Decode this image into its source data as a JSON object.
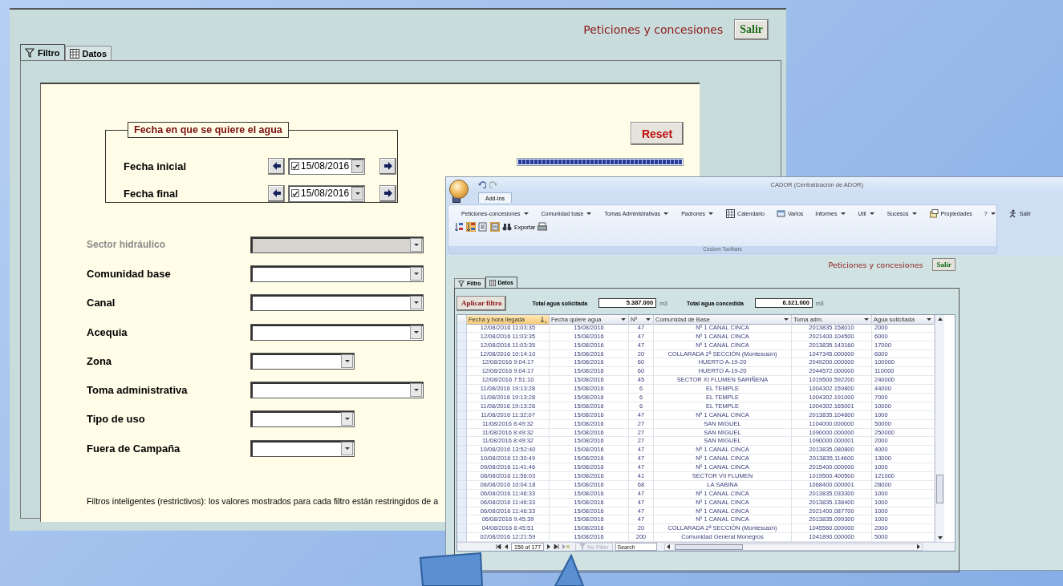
{
  "filter_window": {
    "title": "Peticiones y concesiones",
    "exit_button": "Salir",
    "tabs": [
      {
        "label": "Filtro",
        "selected": true
      },
      {
        "label": "Datos",
        "selected": false
      }
    ],
    "date_group": {
      "legend": "Fecha en que se quiere el agua",
      "dates": [
        {
          "label": "Fecha inicial",
          "value": "15/08/2016",
          "checked": true
        },
        {
          "label": "Fecha final",
          "value": "15/08/2016",
          "checked": true
        }
      ]
    },
    "reset_button": "Reset",
    "progress": {
      "level": 1
    },
    "filters": [
      {
        "label": "Sector hidráulico",
        "kind": "long",
        "disabled": true
      },
      {
        "label": "Comunidad base",
        "kind": "long",
        "disabled": false
      },
      {
        "label": "Canal",
        "kind": "long",
        "disabled": false
      },
      {
        "label": "Acequia",
        "kind": "long",
        "disabled": false
      },
      {
        "label": "Zona",
        "kind": "short",
        "disabled": false
      },
      {
        "label": "Toma administrativa",
        "kind": "long",
        "disabled": false
      },
      {
        "label": "Tipo de uso",
        "kind": "short",
        "disabled": false
      },
      {
        "label": "Fuera de Campaña",
        "kind": "short",
        "disabled": false
      }
    ],
    "note": "Filtros inteligentes (restrictivos): los valores mostrados para cada filtro están restringidos de a"
  },
  "data_window": {
    "app_title": "CADOR (Centralización de ADOR)",
    "ribbon_tab": "Add-Ins",
    "menu": [
      {
        "label": "Peticiones-concesiones",
        "dropdown": true
      },
      {
        "label": "Comunidad base",
        "dropdown": true
      },
      {
        "label": "Tomas Administrativas",
        "dropdown": true
      },
      {
        "label": "Padrones",
        "dropdown": true
      },
      {
        "label": "Calendario",
        "dropdown": false
      },
      {
        "label": "Varios",
        "dropdown": false
      },
      {
        "label": "Informes",
        "dropdown": true
      },
      {
        "label": "Util",
        "dropdown": true
      },
      {
        "label": "Sucesos",
        "dropdown": true
      },
      {
        "label": "Propiedades",
        "dropdown": false
      },
      {
        "label": "?",
        "dropdown": true
      },
      {
        "label": "Salir",
        "dropdown": false
      }
    ],
    "toolbar_button": "Exportar",
    "group_label": "Custom Toolbars",
    "form_title": "Peticiones y concesiones",
    "exit_button": "Salir",
    "tabs": [
      {
        "label": "Filtro",
        "selected": false
      },
      {
        "label": "Datos",
        "selected": true
      }
    ],
    "apply_button": "Aplicar filtro",
    "totals": [
      {
        "label": "Total agua solicitada",
        "value": "5.387.000",
        "unit": "m3"
      },
      {
        "label": "Total agua concedida",
        "value": "6.321.000",
        "unit": "m3"
      }
    ],
    "table": {
      "columns": [
        {
          "label": "Fecha y hora llegada",
          "sorted": true
        },
        {
          "label": "Fecha quiere agua",
          "sorted": false
        },
        {
          "label": "Nº",
          "sorted": false
        },
        {
          "label": "Comunidad de Base",
          "sorted": false
        },
        {
          "label": "Toma adm.",
          "sorted": false
        },
        {
          "label": "Agua solicitada",
          "sorted": false
        }
      ],
      "rows": [
        [
          "12/08/2016 11:03:35",
          "15/08/2016",
          "47",
          "Nº 1 CANAL CINCA",
          "2013835.158010",
          "2000"
        ],
        [
          "12/08/2016 11:03:35",
          "15/08/2016",
          "47",
          "Nº 1 CANAL CINCA",
          "2021400.104500",
          "6000"
        ],
        [
          "12/08/2016 11:03:35",
          "15/08/2016",
          "47",
          "Nº 1 CANAL CINCA",
          "2013835.143160",
          "17000"
        ],
        [
          "12/08/2016 10:14:10",
          "15/08/2016",
          "20",
          "COLLARADA 2ª SECCIÓN (Montesusín)",
          "1047345.000000",
          "6000"
        ],
        [
          "12/08/2016 9:04:17",
          "15/08/2016",
          "60",
          "HUERTO A-19-20",
          "2049200.000000",
          "100000"
        ],
        [
          "12/08/2016 9:04:17",
          "15/08/2016",
          "60",
          "HUERTO A-19-20",
          "2044572.000000",
          "110000"
        ],
        [
          "12/08/2016 7:51:10",
          "15/08/2016",
          "45",
          "SECTOR XI FLUMEN SARIÑENA",
          "1019500.592200",
          "240000"
        ],
        [
          "11/08/2016 19:13:28",
          "15/08/2016",
          "6",
          "EL TEMPLE",
          "1004302.159800",
          "44000"
        ],
        [
          "11/08/2016 19:13:28",
          "15/08/2016",
          "6",
          "EL TEMPLE",
          "1004302.191000",
          "7000"
        ],
        [
          "11/08/2016 19:13:28",
          "15/08/2016",
          "6",
          "EL TEMPLE",
          "1004302.165001",
          "10000"
        ],
        [
          "11/08/2016 11:32:07",
          "15/08/2016",
          "47",
          "Nº 1 CANAL CINCA",
          "2013835.104800",
          "1000"
        ],
        [
          "11/08/2016 8:49:32",
          "15/08/2016",
          "27",
          "SAN MIGUEL",
          "1104000.000000",
          "50000"
        ],
        [
          "11/08/2016 8:49:32",
          "15/08/2016",
          "27",
          "SAN MIGUEL",
          "1090000.000000",
          "250000"
        ],
        [
          "11/08/2016 8:49:32",
          "15/08/2016",
          "27",
          "SAN MIGUEL",
          "1090000.000001",
          "2000"
        ],
        [
          "10/08/2016 13:52:40",
          "15/08/2016",
          "47",
          "Nº 1 CANAL CINCA",
          "2013835.080800",
          "4000"
        ],
        [
          "10/08/2016 11:30:49",
          "15/08/2016",
          "47",
          "Nº 1 CANAL CINCA",
          "2013835.114600",
          "13000"
        ],
        [
          "09/08/2016 11:41:46",
          "15/08/2016",
          "47",
          "Nº 1 CANAL CINCA",
          "2015400.000000",
          "1000"
        ],
        [
          "08/08/2016 11:56:03",
          "15/08/2016",
          "41",
          "SECTOR VII FLUMEN",
          "1019500.400500",
          "121000"
        ],
        [
          "08/08/2016 10:04:18",
          "15/08/2016",
          "68",
          "LA SABINA",
          "1068400.000001",
          "28000"
        ],
        [
          "06/08/2016 11:46:33",
          "15/08/2016",
          "47",
          "Nº 1 CANAL CINCA",
          "2013835.033300",
          "1000"
        ],
        [
          "06/08/2016 11:46:33",
          "15/08/2016",
          "47",
          "Nº 1 CANAL CINCA",
          "2013835.138400",
          "1000"
        ],
        [
          "06/08/2016 11:46:33",
          "15/08/2016",
          "47",
          "Nº 1 CANAL CINCA",
          "2021400.087700",
          "1000"
        ],
        [
          "06/08/2016 9:45:39",
          "15/08/2016",
          "47",
          "Nº 1 CANAL CINCA",
          "2013835.099300",
          "1000"
        ],
        [
          "04/08/2016 8:45:51",
          "15/08/2016",
          "20",
          "COLLARADA 2ª SECCIÓN (Montesusín)",
          "1045560.000000",
          "2000"
        ],
        [
          "02/08/2016 12:21:59",
          "15/08/2016",
          "200",
          "Comunidad General Monegros",
          "1041890.000000",
          "5000"
        ]
      ]
    },
    "navigation": {
      "position": "150 of 177",
      "filter": "No Filter",
      "search_placeholder": "Search"
    }
  }
}
